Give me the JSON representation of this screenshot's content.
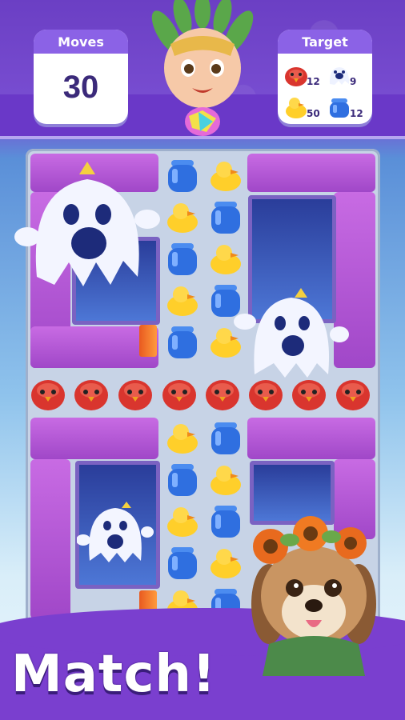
{
  "hud": {
    "moves_label": "Moves",
    "moves_value": "30",
    "target_label": "Target",
    "targets": [
      {
        "icon": "red-bird-icon",
        "count": "12"
      },
      {
        "icon": "ghost-icon",
        "count": "9"
      },
      {
        "icon": "duck-icon",
        "count": "50"
      },
      {
        "icon": "blue-pot-icon",
        "count": "12"
      }
    ]
  },
  "banner": {
    "text": "Match!"
  },
  "colors": {
    "purple": "#7a3fcf",
    "gel": "#b35ad6",
    "red": "#d9352e",
    "blue": "#2f6fe0",
    "yellow": "#ffcf2a"
  }
}
